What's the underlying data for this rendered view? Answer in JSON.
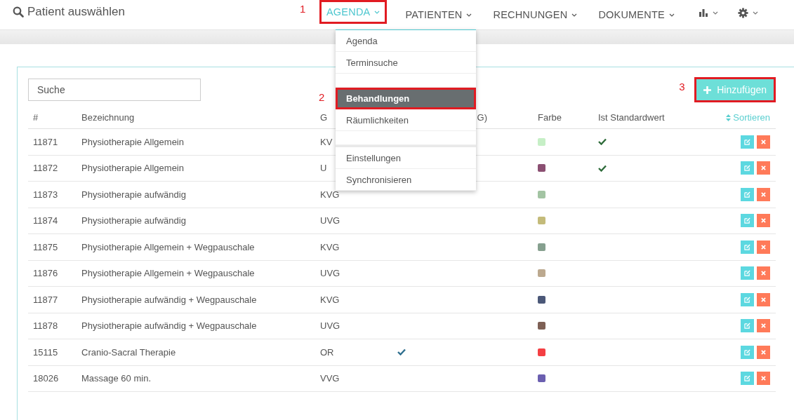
{
  "header": {
    "search_label": "Patient auswählen",
    "nav": [
      {
        "label": "AGENDA",
        "selected": true,
        "annotation": "1"
      },
      {
        "label": "PATIENTEN",
        "selected": false
      },
      {
        "label": "RECHNUNGEN",
        "selected": false
      },
      {
        "label": "DOKUMENTE",
        "selected": false
      }
    ]
  },
  "dropdown": [
    {
      "kind": "item",
      "label": "Agenda",
      "selected": false
    },
    {
      "kind": "item",
      "label": "Terminsuche",
      "selected": false
    },
    {
      "kind": "spacer"
    },
    {
      "kind": "item",
      "label": "Behandlungen",
      "selected": true,
      "annotation": "2"
    },
    {
      "kind": "item",
      "label": "Räumlichkeiten",
      "selected": false
    },
    {
      "kind": "spacer"
    },
    {
      "kind": "divider"
    },
    {
      "kind": "item",
      "label": "Einstellungen",
      "selected": false
    },
    {
      "kind": "item",
      "label": "Synchronisieren",
      "selected": false
    }
  ],
  "search": {
    "placeholder": "Suche"
  },
  "add_button": {
    "label": "Hinzufügen",
    "annotation": "3"
  },
  "table": {
    "columns": [
      "#",
      "Bezeichnung",
      "G",
      "G)",
      "Farbe",
      "Ist Standardwert",
      "Sortieren"
    ],
    "rows": [
      {
        "id": "11871",
        "name": "Physiotherapie Allgemein",
        "law": "KV",
        "checked": false,
        "color": "#c6efc6",
        "default": true
      },
      {
        "id": "11872",
        "name": "Physiotherapie Allgemein",
        "law": "U",
        "checked": false,
        "color": "#8b4f72",
        "default": true
      },
      {
        "id": "11873",
        "name": "Physiotherapie aufwändig",
        "law": "KVG",
        "checked": false,
        "color": "#a3c4a3",
        "default": false
      },
      {
        "id": "11874",
        "name": "Physiotherapie aufwändig",
        "law": "UVG",
        "checked": false,
        "color": "#c4bb7a",
        "default": false
      },
      {
        "id": "11875",
        "name": "Physiotherapie Allgemein + Wegpauschale",
        "law": "KVG",
        "checked": false,
        "color": "#86a08f",
        "default": false
      },
      {
        "id": "11876",
        "name": "Physiotherapie Allgemein + Wegpauschale",
        "law": "UVG",
        "checked": false,
        "color": "#bca98f",
        "default": false
      },
      {
        "id": "11877",
        "name": "Physiotherapie aufwändig + Wegpauschale",
        "law": "KVG",
        "checked": false,
        "color": "#4b5878",
        "default": false
      },
      {
        "id": "11878",
        "name": "Physiotherapie aufwändig + Wegpauschale",
        "law": "UVG",
        "checked": false,
        "color": "#7e6055",
        "default": false
      },
      {
        "id": "15115",
        "name": "Cranio-Sacral Therapie",
        "law": "OR",
        "checked": true,
        "color": "#f43f43",
        "default": false
      },
      {
        "id": "18026",
        "name": "Massage 60 min.",
        "law": "VVG",
        "checked": false,
        "color": "#6b5fb0",
        "default": false
      }
    ]
  }
}
